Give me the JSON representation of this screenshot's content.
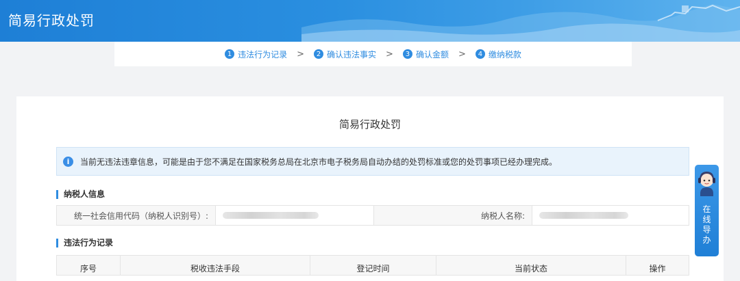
{
  "header": {
    "title": "简易行政处罚"
  },
  "steps": [
    {
      "num": "1",
      "label": "违法行为记录"
    },
    {
      "num": "2",
      "label": "确认违法事实"
    },
    {
      "num": "3",
      "label": "确认金额"
    },
    {
      "num": "4",
      "label": "缴纳税款"
    }
  ],
  "step_separator": ">",
  "main": {
    "title": "简易行政处罚",
    "notice": "当前无违法违章信息，可能是由于您不满足在国家税务总局在北京市电子税务局自动办结的处罚标准或您的处罚事项已经办理完成。",
    "taxpayer": {
      "heading": "纳税人信息",
      "credit_code_label": "统一社会信用代码（纳税人识别号）:",
      "name_label": "纳税人名称:"
    },
    "violations": {
      "heading": "违法行为记录",
      "columns": [
        "序号",
        "税收违法手段",
        "登记时间",
        "当前状态",
        "操作"
      ]
    }
  },
  "online_guide": {
    "label": [
      "在",
      "线",
      "导",
      "办"
    ]
  },
  "colors": {
    "primary": "#2f8ce0",
    "header_start": "#1e7fd6",
    "notice_bg": "#e9f3fc"
  }
}
